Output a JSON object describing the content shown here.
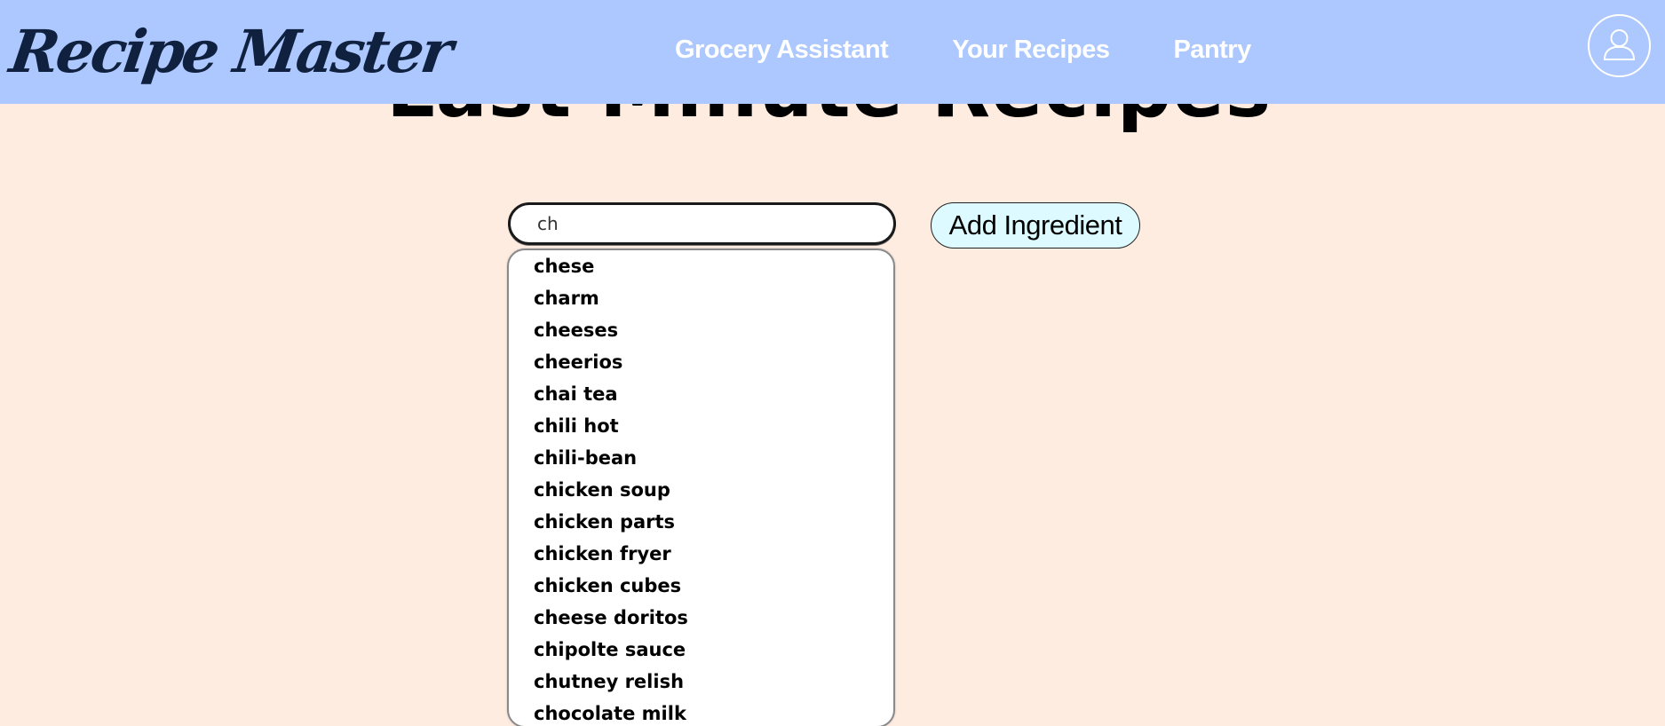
{
  "header": {
    "logo_text": "Recipe Master",
    "nav": [
      {
        "label": "Grocery Assistant"
      },
      {
        "label": "Your Recipes"
      },
      {
        "label": "Pantry"
      }
    ],
    "profile_icon": "user-icon"
  },
  "main": {
    "title": "Last Minute Recipes",
    "search": {
      "value": "ch"
    },
    "add_button_label": "Add Ingredient",
    "suggestions": [
      "chese",
      "charm",
      "cheeses",
      "cheerios",
      "chai tea",
      "chili hot",
      "chili-bean",
      "chicken soup",
      "chicken parts",
      "chicken fryer",
      "chicken cubes",
      "cheese doritos",
      "chipolte sauce",
      "chutney relish",
      "chocolate milk"
    ]
  },
  "colors": {
    "header_bg": "#adc8fe",
    "page_bg": "#ffece0",
    "logo": "#10203f",
    "add_button_bg": "#dcfaff"
  }
}
